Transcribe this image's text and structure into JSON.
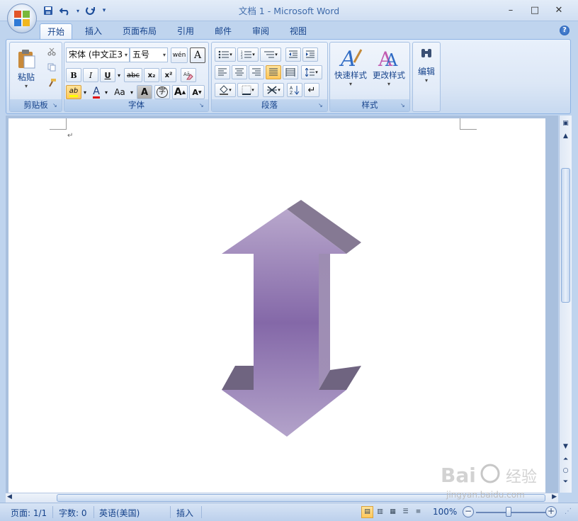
{
  "window": {
    "title": "文档 1 - Microsoft Word",
    "controls": [
      "–",
      "□",
      "✕"
    ]
  },
  "quick_access": {
    "save_icon": "save-icon",
    "undo_icon": "undo-icon",
    "redo_icon": "redo-icon",
    "customize_icon": "chevron-down-icon"
  },
  "ribbon": {
    "tabs": [
      {
        "label": "开始",
        "active": true
      },
      {
        "label": "插入",
        "active": false
      },
      {
        "label": "页面布局",
        "active": false
      },
      {
        "label": "引用",
        "active": false
      },
      {
        "label": "邮件",
        "active": false
      },
      {
        "label": "审阅",
        "active": false
      },
      {
        "label": "视图",
        "active": false
      }
    ],
    "help": "?",
    "groups": {
      "clipboard": {
        "label": "剪贴板",
        "paste": "粘贴"
      },
      "font": {
        "label": "字体",
        "font_name": "宋体 (中文正3",
        "font_size": "五号",
        "bold": "B",
        "italic": "I",
        "underline": "U",
        "strike": "abc",
        "subscript": "x₂",
        "superscript": "x²",
        "change_case": "Aa",
        "char_shading": "A",
        "enclose": "字",
        "grow": "A",
        "shrink": "A",
        "wen": "wén",
        "char_border": "A",
        "font_color_letter": "A",
        "highlight_letter": "ab"
      },
      "paragraph": {
        "label": "段落"
      },
      "styles": {
        "label": "样式",
        "quick_styles": "快速样式",
        "change_styles": "更改样式"
      },
      "editing": {
        "label": "编辑"
      }
    }
  },
  "document": {
    "paragraph_mark": "↵",
    "shape": "up-down-arrow",
    "shape_color_light": "#b2a0c8",
    "shape_color_mid": "#8a70ab",
    "shape_color_dark": "#6f6182"
  },
  "status_bar": {
    "page": "页面: 1/1",
    "words": "字数: 0",
    "language": "英语(美国)",
    "mode": "插入",
    "zoom": "100%",
    "zoom_out": "−",
    "zoom_in": "+"
  },
  "watermark": {
    "brand": "Bai",
    "brand_suffix": "经验",
    "url": "jingyan.baidu.com"
  }
}
